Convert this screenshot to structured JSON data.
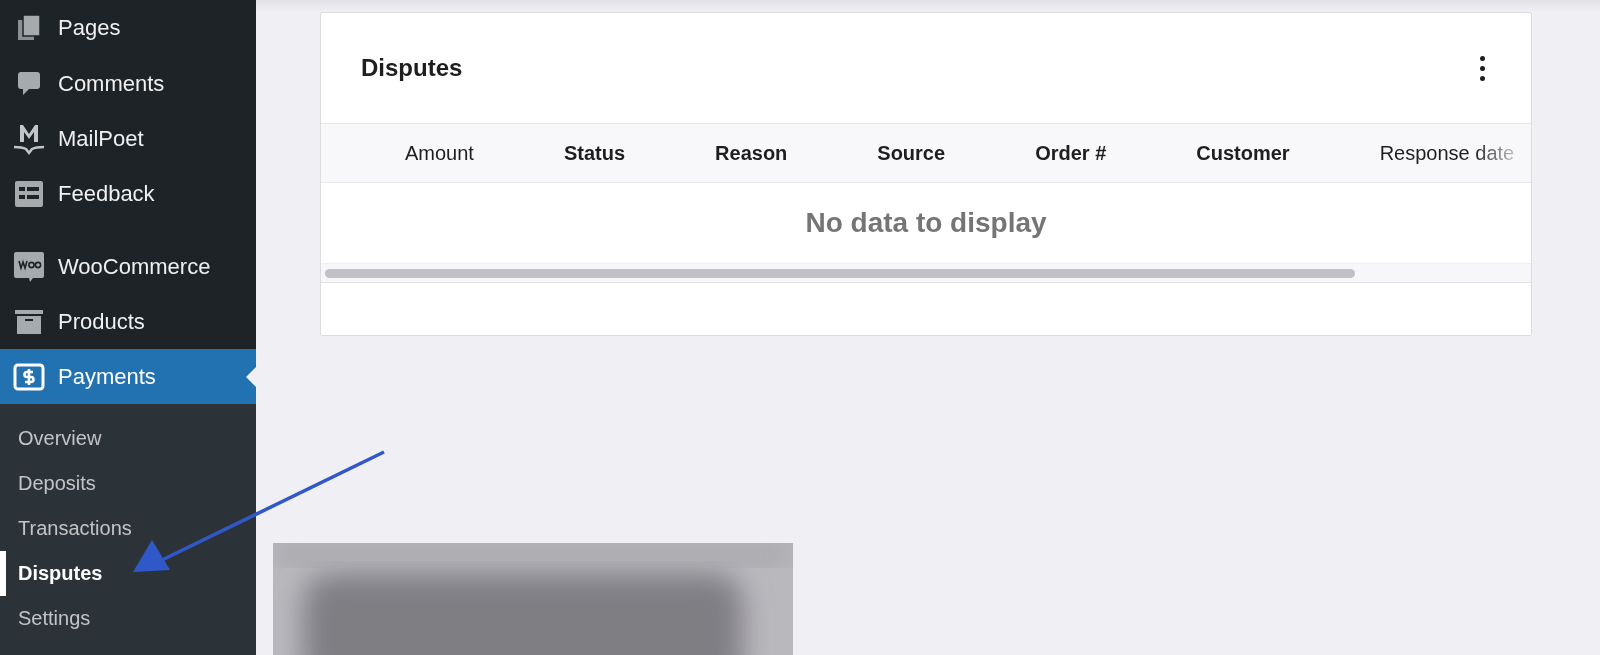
{
  "sidebar": {
    "menu": [
      {
        "label": "Pages",
        "selected": false
      },
      {
        "label": "Comments",
        "selected": false
      },
      {
        "label": "MailPoet",
        "selected": false
      },
      {
        "label": "Feedback",
        "selected": false
      },
      {
        "label": "WooCommerce",
        "selected": false
      },
      {
        "label": "Products",
        "selected": false
      },
      {
        "label": "Payments",
        "selected": true
      }
    ],
    "submenu": [
      {
        "label": "Overview",
        "selected": false
      },
      {
        "label": "Deposits",
        "selected": false
      },
      {
        "label": "Transactions",
        "selected": false
      },
      {
        "label": "Disputes",
        "selected": true
      },
      {
        "label": "Settings",
        "selected": false
      }
    ]
  },
  "card": {
    "title": "Disputes",
    "columns": [
      {
        "label": "Amount",
        "sortable": true
      },
      {
        "label": "Status",
        "sortable": false
      },
      {
        "label": "Reason",
        "sortable": false
      },
      {
        "label": "Source",
        "sortable": false
      },
      {
        "label": "Order #",
        "sortable": false
      },
      {
        "label": "Customer",
        "sortable": false
      },
      {
        "label": "Response date",
        "sortable": true
      }
    ],
    "empty_message": "No data to display"
  }
}
